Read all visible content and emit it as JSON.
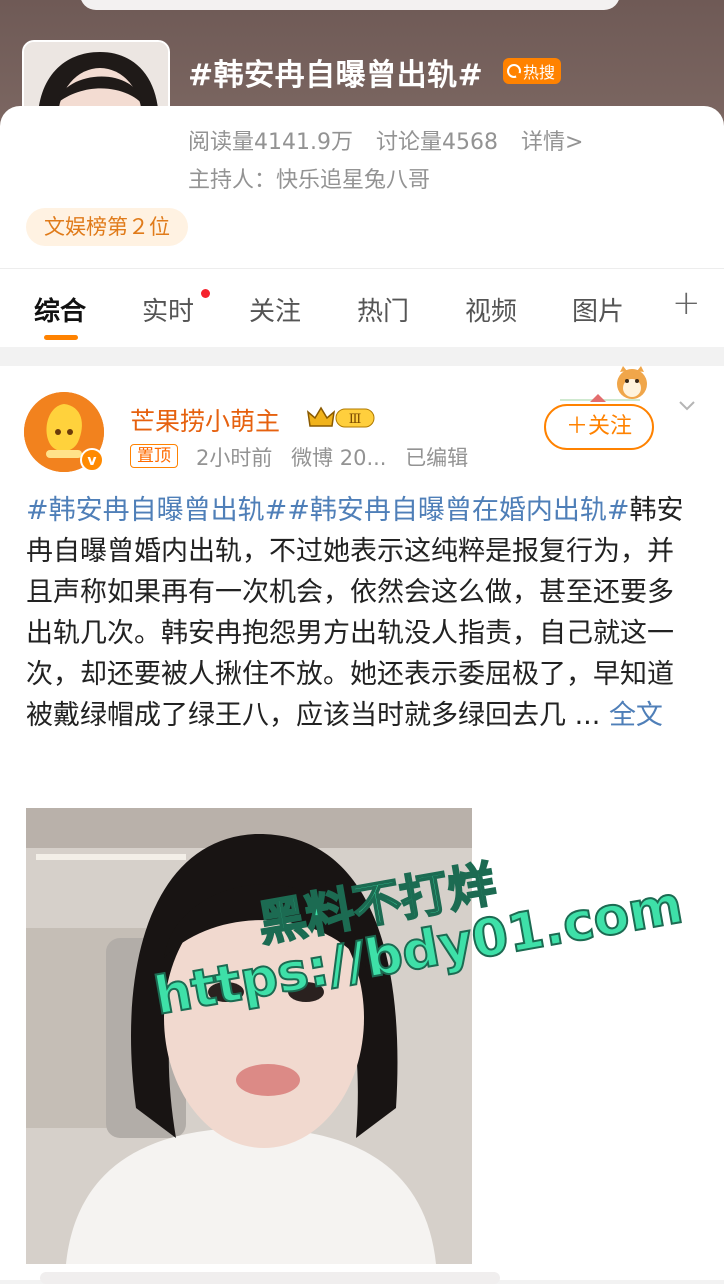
{
  "topic": {
    "title": "#韩安冉自曝曾出轨#",
    "hot_badge": "热搜",
    "reads": "阅读量4141.9万",
    "discussions": "讨论量4568",
    "details": "详情>",
    "host": "主持人：快乐追星兔八哥",
    "rank": "文娱榜第２位"
  },
  "tabs": [
    {
      "label": "综合",
      "active": true
    },
    {
      "label": "实时",
      "has_dot": true
    },
    {
      "label": "关注"
    },
    {
      "label": "热门"
    },
    {
      "label": "视频"
    },
    {
      "label": "图片"
    }
  ],
  "tab_more": "+",
  "post": {
    "user_name": "芒果捞小萌主",
    "vip_level": "Ⅲ",
    "pinned_label": "置顶",
    "time": "2小时前",
    "source": "微博 20...",
    "edited": "已编辑",
    "follow_label": "＋关注",
    "hashtags": "#韩安冉自曝曾出轨##韩安冉自曝曾在婚内出轨#",
    "body": "韩安冉自曝曾婚内出轨，不过她表示这纯粹是报复行为，并且声称如果再有一次机会，依然会这么做，甚至还要多出轨几次。韩安冉抱怨男方出轨没人指责，自己就这一次，却还要被人揪住不放。她还表示委屈极了，早知道被戴绿帽成了绿王八，应该当时就多绿回去几 ...",
    "full_text_link": "全文"
  },
  "watermark": {
    "line1": "黑料不打烊",
    "line2": "https://bdy01.com"
  },
  "colors": {
    "accent": "#ff8200",
    "link": "#4f7fb8",
    "username": "#e6610f",
    "watermark": "#3ee0a8"
  }
}
